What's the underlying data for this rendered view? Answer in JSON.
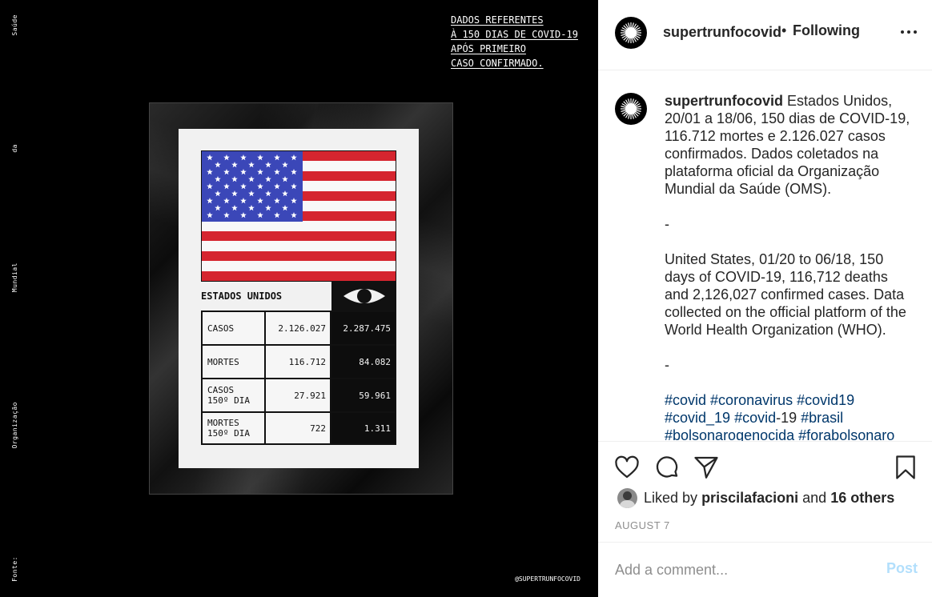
{
  "image": {
    "side_words": [
      "Saúde",
      "da",
      "Mundial",
      "Organização",
      "Fonte:"
    ],
    "header_lines": [
      "DADOS REFERENTES",
      "À 150 DIAS DE COVID-19",
      "APÓS PRIMEIRO",
      "CASO CONFIRMADO."
    ],
    "credit": "@SUPERTRUNFOCOVID",
    "card": {
      "country": "ESTADOS UNIDOS",
      "rows": [
        {
          "label": "CASOS",
          "value": "2.126.027",
          "compare": "2.287.475"
        },
        {
          "label": "MORTES",
          "value": "116.712",
          "compare": "84.082"
        },
        {
          "label": "CASOS\n150º DIA",
          "value": "27.921",
          "compare": "59.961"
        },
        {
          "label": "MORTES\n150º DIA",
          "value": "722",
          "compare": "1.311"
        }
      ]
    }
  },
  "header": {
    "username": "supertrunfocovid",
    "dot": "•",
    "follow_status": "Following"
  },
  "caption": {
    "username": "supertrunfocovid",
    "pt_text": " Estados Unidos, 20/01 a 18/06, 150 dias de COVID-19, 116.712 mortes e 2.126.027 casos confirmados. Dados coletados na plataforma oficial da Organização Mundial da Saúde (OMS).",
    "sep1": "-",
    "en_text": "United States, 01/20 to 06/18, 150 days of COVID-19, 116,712 deaths and 2,126,027 confirmed cases. Data collected on the official platform of the World Health Organization (WHO).",
    "sep2": "-",
    "tags_line1": [
      "#covid",
      "#coronavirus",
      "#covid19"
    ],
    "tags_line2": [
      "#covid_19",
      "#covid"
    ],
    "tags_line2_suffix": "-19",
    "tags_line2_end": "#brasil",
    "tags_line3": [
      "#bolsonarogenocida",
      "#forabolsonaro"
    ]
  },
  "actions": {
    "liked_by_prefix": "Liked by",
    "liker": "priscilafacioni",
    "and": "and",
    "others": "16 others",
    "date": "AUGUST 7"
  },
  "comment": {
    "placeholder": "Add a comment...",
    "post_label": "Post"
  },
  "icons": [
    "heart-icon",
    "comment-icon",
    "share-icon",
    "bookmark-icon",
    "more-icon",
    "eye-icon"
  ]
}
